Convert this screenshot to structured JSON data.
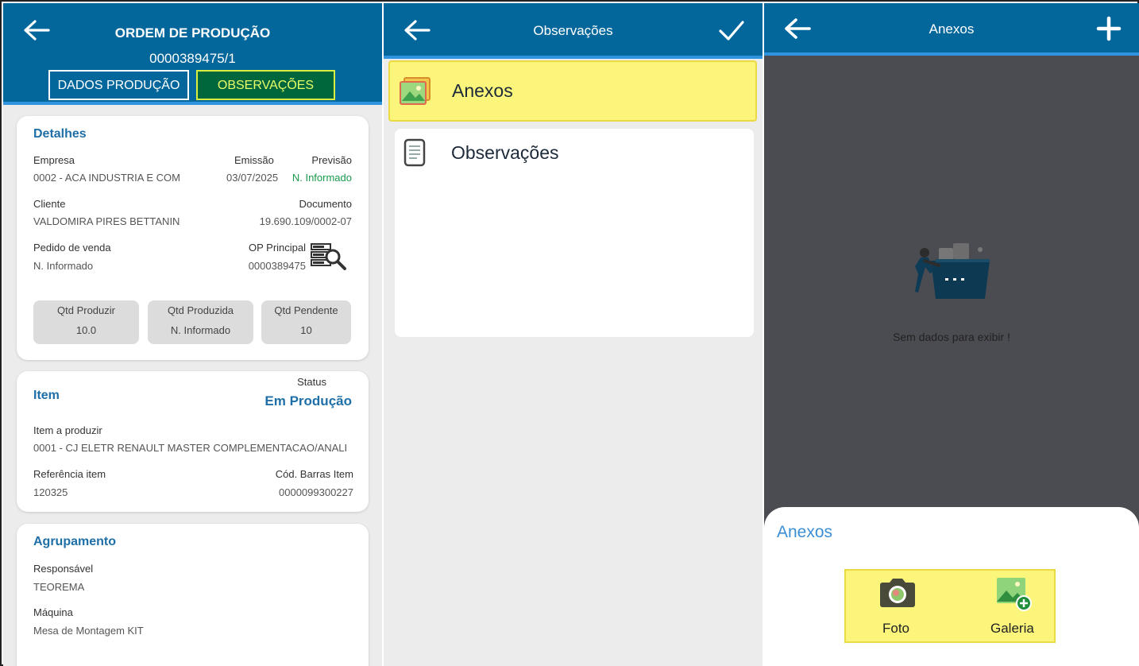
{
  "panel1": {
    "header": {
      "title": "ORDEM DE PRODUÇÃO",
      "order": "0000389475/1"
    },
    "tabs": [
      {
        "label": "DADOS PRODUÇÃO"
      },
      {
        "label": "OBSERVAÇÕES"
      }
    ],
    "details": {
      "title": "Detalhes",
      "empresa_label": "Empresa",
      "empresa_value": "0002 - ACA INDUSTRIA E COM",
      "emissao_label": "Emissão",
      "emissao_value": "03/07/2025",
      "previsao_label": "Previsão",
      "previsao_value": "N. Informado",
      "cliente_label": "Cliente",
      "cliente_value": "VALDOMIRA PIRES BETTANIN",
      "documento_label": "Documento",
      "documento_value": "19.690.109/0002-07",
      "pedido_label": "Pedido de venda",
      "pedido_value": "N. Informado",
      "op_label": "OP Principal",
      "op_value": "0000389475",
      "qtd": [
        {
          "label": "Qtd Produzir",
          "value": "10.0"
        },
        {
          "label": "Qtd Produzida",
          "value": "N. Informado"
        },
        {
          "label": "Qtd Pendente",
          "value": "10"
        }
      ]
    },
    "item": {
      "title": "Item",
      "status_label": "Status",
      "status_value": "Em Produção",
      "produzir_label": "Item a produzir",
      "produzir_value": "0001 - CJ ELETR RENAULT MASTER COMPLEMENTACAO/ANALI",
      "referencia_label": "Referência item",
      "referencia_value": "120325",
      "barras_label": "Cód. Barras Item",
      "barras_value": "0000099300227"
    },
    "agrupamento": {
      "title": "Agrupamento",
      "responsavel_label": "Responsável",
      "responsavel_value": "TEOREMA",
      "maquina_label": "Máquina",
      "maquina_value": "Mesa de Montagem KIT"
    }
  },
  "panel2": {
    "header": {
      "title": "Observações"
    },
    "items": [
      {
        "label": "Anexos"
      },
      {
        "label": "Observações"
      }
    ]
  },
  "panel3": {
    "header": {
      "title": "Anexos"
    },
    "empty_text": "Sem dados para exibir !",
    "sheet": {
      "title": "Anexos",
      "foto_label": "Foto",
      "galeria_label": "Galeria"
    }
  },
  "colors": {
    "header": "#03679c",
    "accent_blue": "#1e6fa8",
    "highlight": "#fbf57c",
    "green": "#189a4a"
  }
}
